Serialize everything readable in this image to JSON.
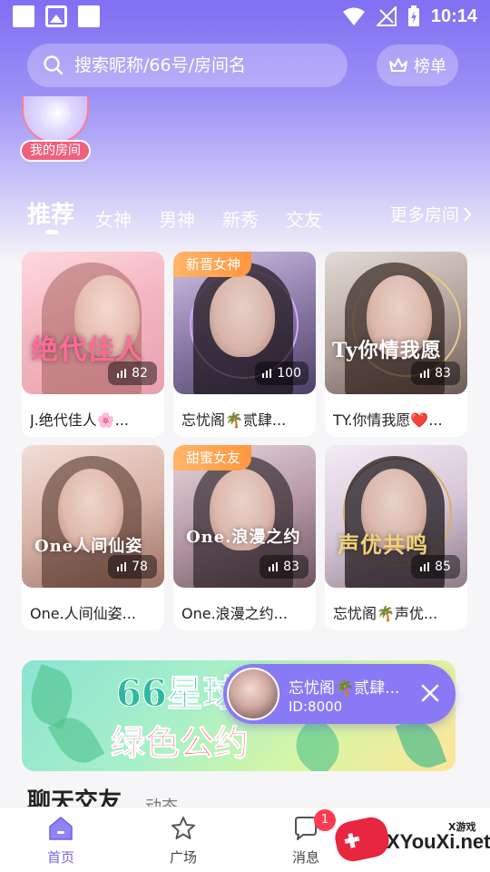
{
  "status_bar": {
    "time": "10:14"
  },
  "search": {
    "placeholder": "搜索昵称/66号/房间名"
  },
  "rank_button": {
    "label": "榜单"
  },
  "my_room": {
    "label": "我的房间"
  },
  "tabs": [
    {
      "label": "推荐",
      "active": true
    },
    {
      "label": "女神"
    },
    {
      "label": "男神"
    },
    {
      "label": "新秀"
    },
    {
      "label": "交友"
    }
  ],
  "more_rooms": {
    "label": "更多房间"
  },
  "rooms": [
    {
      "title": "J.绝代佳人🌸...",
      "count": "82",
      "caption": "绝代佳人",
      "tag": ""
    },
    {
      "title": "忘忧阁🌴贰肆...",
      "count": "100",
      "caption": "",
      "tag": "新晋女神"
    },
    {
      "title": "TY.你情我愿❤️...",
      "count": "83",
      "caption": "Ty你情我愿",
      "tag": ""
    },
    {
      "title": "One.人间仙姿...",
      "count": "78",
      "caption": "One人间仙姿",
      "tag": ""
    },
    {
      "title": "One.浪漫之约...",
      "count": "83",
      "caption": "One.浪漫之约",
      "tag": "甜蜜女友"
    },
    {
      "title": "忘忧阁🌴声优...",
      "count": "85",
      "caption": "声优共鸣",
      "tag": ""
    }
  ],
  "banner": {
    "title": "66星球",
    "subtitle": "绿色公约"
  },
  "mini_player": {
    "title": "忘忧阁🌴贰肆...",
    "id": "ID:8000"
  },
  "section": {
    "title": "聊天交友",
    "sub": "动态"
  },
  "bottom_nav": [
    {
      "label": "首页",
      "active": true
    },
    {
      "label": "广场"
    },
    {
      "label": "消息",
      "badge": "1"
    }
  ],
  "watermark": {
    "text": "XYouXi.net",
    "small": "X游戏"
  },
  "colors": {
    "accent": "#7466ef",
    "badge": "#ff3b4f",
    "tag": "#ff9d4a"
  }
}
